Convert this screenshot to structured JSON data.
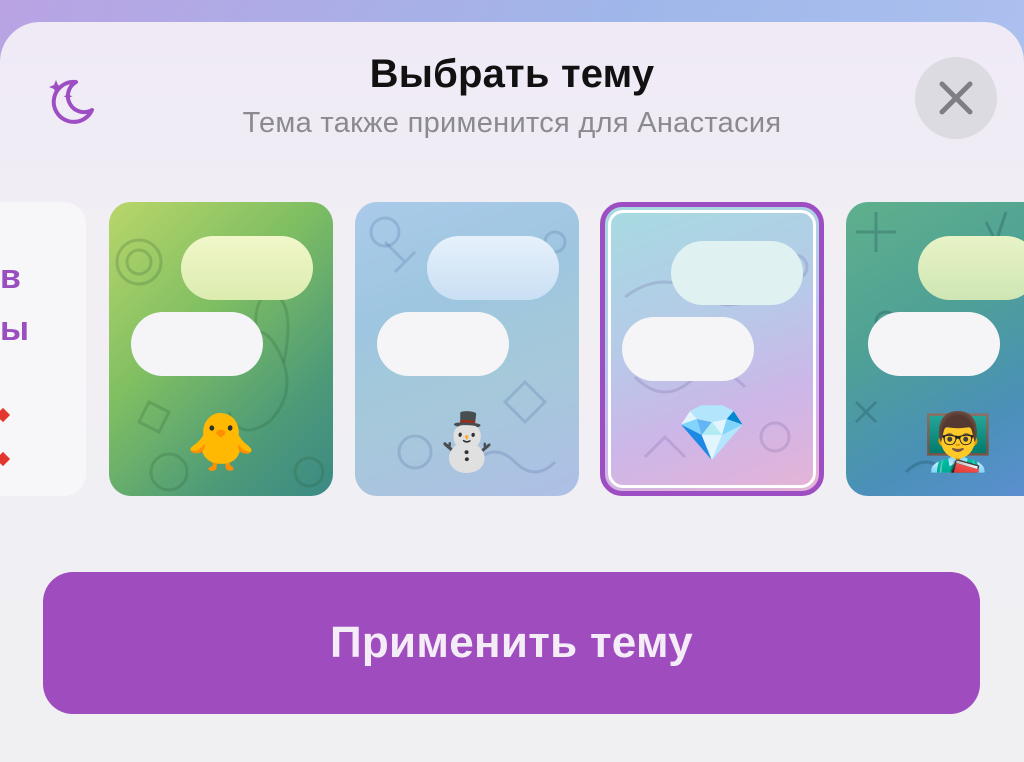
{
  "header": {
    "title": "Выбрать тему",
    "subtitle": "Тема также применится для Анастасия"
  },
  "partial_card": {
    "line1": "в",
    "line2": "ы"
  },
  "themes": [
    {
      "emoji": "🐥",
      "colors": [
        "#b9d66a",
        "#3b8a85"
      ]
    },
    {
      "emoji": "⛄",
      "colors": [
        "#a9cbe9",
        "#aebfe6"
      ]
    },
    {
      "emoji": "💎",
      "colors": [
        "#a6dbe0",
        "#e6b3d6"
      ],
      "selected": true
    },
    {
      "emoji": "👨‍🏫",
      "colors": [
        "#5fb08c",
        "#5b8fd0"
      ]
    }
  ],
  "apply_button": {
    "label": "Применить тему"
  },
  "accent_color": "#9f4cbe"
}
